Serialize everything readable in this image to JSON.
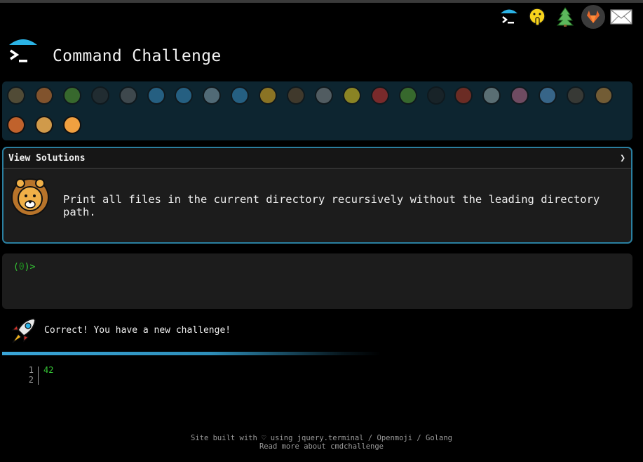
{
  "header": {
    "title": "Command Challenge",
    "icons": [
      "terminal-umbrella-icon",
      "shushing-face-icon",
      "tree-icon",
      "gitlab-icon",
      "mail-icon"
    ]
  },
  "animals": [
    "snail",
    "butterfly",
    "caterpillar",
    "ant",
    "spider-web",
    "whale",
    "dolphin",
    "dolphin-2",
    "fish",
    "tropical-fish",
    "blowfish",
    "wolf",
    "bee",
    "ladybug",
    "cricket",
    "spider",
    "scorpion",
    "fly",
    "worm",
    "microbe",
    "gorilla",
    "dog",
    "fox",
    "cat",
    "tiger"
  ],
  "panel": {
    "toggle_label": "View Solutions",
    "chevron": "❯",
    "description": "Print all files in the current directory recursively without the leading directory path."
  },
  "terminal": {
    "prompt_open": "(",
    "prompt_code": "0",
    "prompt_close": ")>"
  },
  "message": {
    "text": "Correct! You have a new challenge!"
  },
  "output": {
    "line_numbers": "1\n2",
    "value": "42"
  },
  "footer": {
    "line1": "Site built with ♡ using jquery.terminal / Openmoji / Golang",
    "line2": "Read more about cmdchallenge"
  },
  "colors": {
    "accent": "#2a7fa0",
    "panel_bg": "#0d2530",
    "prompt_green": "#36c936"
  }
}
